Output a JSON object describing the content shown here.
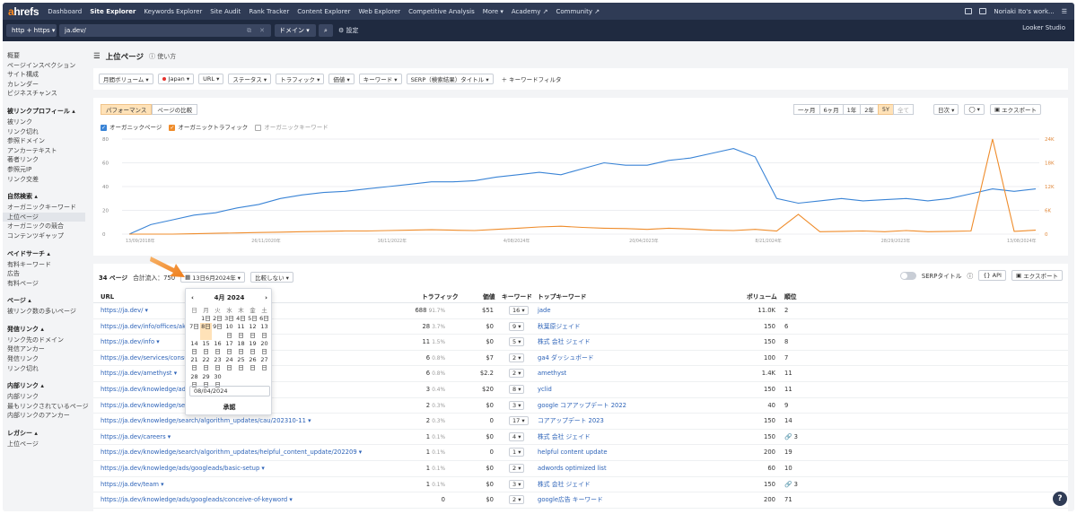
{
  "brand": {
    "a": "a",
    "rest": "hrefs"
  },
  "topnav": {
    "items": [
      "Dashboard",
      "Site Explorer",
      "Keywords Explorer",
      "Site Audit",
      "Rank Tracker",
      "Content Explorer",
      "Web Explorer",
      "Competitive Analysis",
      "More ▾",
      "Academy ↗",
      "Community ↗"
    ],
    "user": "Noriaki Ito's work..."
  },
  "searchbar": {
    "protocol": "http + https ▾",
    "url": "ja.dev/",
    "mode": "ドメイン ▾",
    "settings": "⚙ 設定",
    "looker": "Looker Studio"
  },
  "sidebar": {
    "top": [
      "概要",
      "ページインスペクション",
      "サイト構成",
      "カレンダー",
      "ビジネスチャンス"
    ],
    "sections": [
      {
        "h": "被リンクプロフィール ▴",
        "items": [
          "被リンク",
          "リンク切れ",
          "参照ドメイン",
          "アンカーテキスト",
          "著者リンク",
          "参照元IP",
          "リンク交差"
        ]
      },
      {
        "h": "自然検索 ▴",
        "items": [
          "オーガニックキーワード",
          "上位ページ",
          "オーガニックの競合",
          "コンテンツギャップ"
        ]
      },
      {
        "h": "ペイドサーチ ▴",
        "items": [
          "有料キーワード",
          "広告",
          "有料ページ"
        ]
      },
      {
        "h": "ページ ▴",
        "items": [
          "被リンク数の多いページ"
        ]
      },
      {
        "h": "発信リンク ▴",
        "items": [
          "リンク先のドメイン",
          "発信アンカー",
          "発信リンク",
          "リンク切れ"
        ]
      },
      {
        "h": "内部リンク ▴",
        "items": [
          "内部リンク",
          "最もリンクされているページ",
          "内部リンクのアンカー"
        ]
      },
      {
        "h": "レガシー ▴",
        "items": [
          "上位ページ"
        ]
      }
    ]
  },
  "page": {
    "title": "上位ページ",
    "help": "使い方"
  },
  "filters": [
    "月間ボリューム ▾",
    "Japan ▾",
    "URL ▾",
    "ステータス ▾",
    "トラフィック ▾",
    "価値 ▾",
    "キーワード ▾",
    "SERP（検索結果）タイトル ▾"
  ],
  "keyword_filter": "＋ キーワードフィルタ",
  "chart_tabs": [
    "パフォーマンス",
    "ページの比較"
  ],
  "periods": [
    "一ヶ月",
    "6ヶ月",
    "1年",
    "2年",
    "5Y",
    "全て"
  ],
  "period_selected": "5Y",
  "granularity": "日次 ▾",
  "export": "エクスポート",
  "legend": [
    "オーガニックページ",
    "オーガニックトラフィック",
    "オーガニックキーワード"
  ],
  "chart_data": {
    "type": "line",
    "y_left": {
      "ticks": [
        "0",
        "20",
        "40",
        "60",
        "80"
      ],
      "range": [
        0,
        80
      ]
    },
    "y_right": {
      "ticks": [
        "0",
        "6K",
        "12K",
        "18K",
        "24K"
      ],
      "range": [
        0,
        24000
      ]
    },
    "x_labels": [
      "13/09/2018年",
      "26/11/2020年",
      "16/11/2022年",
      "4/08/2024年",
      "20/04/2023年",
      "8/21/2024年",
      "28/29/2023年",
      "13/08/2024年"
    ],
    "series": [
      {
        "name": "オーガニックページ",
        "color": "#3a84d6",
        "values": [
          0,
          8,
          12,
          16,
          18,
          22,
          25,
          30,
          33,
          35,
          36,
          38,
          40,
          42,
          44,
          44,
          45,
          48,
          50,
          52,
          50,
          55,
          60,
          58,
          58,
          62,
          64,
          68,
          72,
          65,
          30,
          26,
          28,
          30,
          28,
          29,
          30,
          28,
          30,
          34,
          38,
          36,
          38
        ]
      },
      {
        "name": "オーガニックトラフィック",
        "color": "#ef8c2b",
        "values": [
          0,
          0,
          0,
          100,
          200,
          300,
          400,
          500,
          600,
          700,
          800,
          800,
          900,
          1000,
          1100,
          1000,
          900,
          1200,
          1500,
          1800,
          2000,
          1700,
          1500,
          1400,
          1200,
          1500,
          1300,
          1000,
          900,
          1200,
          800,
          5000,
          600,
          700,
          800,
          600,
          900,
          600,
          700,
          800,
          24000,
          700,
          1000
        ]
      }
    ]
  },
  "table": {
    "count": "34 ページ",
    "total_label": "合計流入：750",
    "date_btn": "13日6月2024年 ▾",
    "compare_btn": "比較しない ▾",
    "serp_title": "SERPタイトル",
    "api": "API",
    "export": "エクスポート",
    "headers": [
      "URL",
      "トラフィック",
      "価値",
      "キーワード",
      "トップキーワード",
      "ボリューム",
      "順位"
    ],
    "rows": [
      {
        "url": "https://ja.dev/ ▾",
        "traffic": "688",
        "pct": "91.7%",
        "value": "$51",
        "kw": "16",
        "topkw": "jade",
        "vol": "11.0K",
        "pos": "2",
        "link": false
      },
      {
        "url": "https://ja.dev/info/offices/akih...",
        "traffic": "28",
        "pct": "3.7%",
        "value": "$0",
        "kw": "9",
        "topkw": "秋葉原ジェイド",
        "vol": "150",
        "pos": "6",
        "link": false
      },
      {
        "url": "https://ja.dev/info ▾",
        "traffic": "11",
        "pct": "1.5%",
        "value": "$0",
        "kw": "5",
        "topkw": "株式 会社 ジェイド",
        "vol": "150",
        "pos": "8",
        "link": false
      },
      {
        "url": "https://ja.dev/services/consult... shboards ▾",
        "traffic": "6",
        "pct": "0.8%",
        "value": "$7",
        "kw": "2",
        "topkw": "ga4 ダッシュボード",
        "vol": "100",
        "pos": "7",
        "link": false
      },
      {
        "url": "https://ja.dev/amethyst ▾",
        "traffic": "6",
        "pct": "0.8%",
        "value": "$2.2",
        "kw": "2",
        "topkw": "amethyst",
        "vol": "1.4K",
        "pos": "11",
        "link": false
      },
      {
        "url": "https://ja.dev/knowledge/ads/... ads ▾",
        "traffic": "3",
        "pct": "0.4%",
        "value": "$20",
        "kw": "8",
        "topkw": "yclid",
        "vol": "150",
        "pos": "11",
        "link": false
      },
      {
        "url": "https://ja.dev/knowledge/search... 05 ▾",
        "traffic": "2",
        "pct": "0.3%",
        "value": "$0",
        "kw": "3",
        "topkw": "google コアアップデート 2022",
        "vol": "40",
        "pos": "9",
        "link": false
      },
      {
        "url": "https://ja.dev/knowledge/search/algorithm_updates/cau/202310-11 ▾",
        "traffic": "2",
        "pct": "0.3%",
        "value": "0",
        "kw": "17",
        "topkw": "コアアップデート 2023",
        "vol": "150",
        "pos": "14",
        "link": false
      },
      {
        "url": "https://ja.dev/careers ▾",
        "traffic": "1",
        "pct": "0.1%",
        "value": "$0",
        "kw": "4",
        "topkw": "株式 会社 ジェイド",
        "vol": "150",
        "pos": "3",
        "link": true
      },
      {
        "url": "https://ja.dev/knowledge/search/algorithm_updates/helpful_content_update/202209 ▾",
        "traffic": "1",
        "pct": "0.1%",
        "value": "0",
        "kw": "1",
        "topkw": "helpful content update",
        "vol": "200",
        "pos": "19",
        "link": false
      },
      {
        "url": "https://ja.dev/knowledge/ads/googleads/basic-setup ▾",
        "traffic": "1",
        "pct": "0.1%",
        "value": "$0",
        "kw": "2",
        "topkw": "adwords optimized list",
        "vol": "60",
        "pos": "10",
        "link": false
      },
      {
        "url": "https://ja.dev/team ▾",
        "traffic": "1",
        "pct": "0.1%",
        "value": "$0",
        "kw": "3",
        "topkw": "株式 会社 ジェイド",
        "vol": "150",
        "pos": "3",
        "link": true
      },
      {
        "url": "https://ja.dev/knowledge/ads/googleads/conceive-of-keyword ▾",
        "traffic": "0",
        "pct": "",
        "value": "$0",
        "kw": "2",
        "topkw": "google広告 キーワード",
        "vol": "200",
        "pos": "71",
        "link": false
      }
    ]
  },
  "calendar": {
    "month": "4月 2024",
    "weekdays": [
      "日",
      "月",
      "火",
      "水",
      "木",
      "金",
      "土"
    ],
    "weeks": [
      [
        "",
        "1日",
        "2日",
        "3日",
        "4日",
        "5日",
        "6日"
      ],
      [
        "7日",
        "8日",
        "9日",
        "10 日",
        "11 日",
        "12 日",
        "13 日"
      ],
      [
        "14 日",
        "15 日",
        "16 日",
        "17 日",
        "18 日",
        "19 日",
        "20 日"
      ],
      [
        "21 日",
        "22 日",
        "23 日",
        "24 日",
        "25 日",
        "26 日",
        "27 日"
      ],
      [
        "28 日",
        "29 日",
        "30 日",
        "",
        "",
        "",
        ""
      ]
    ],
    "selected": "8日",
    "input": "08/04/2024",
    "ok": "承認"
  }
}
